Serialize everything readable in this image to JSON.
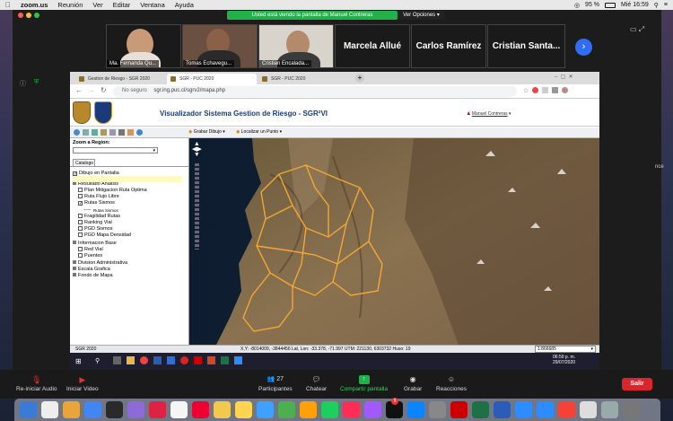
{
  "menubar": {
    "app": "zoom.us",
    "items": [
      "Reunión",
      "Ver",
      "Editar",
      "Ventana",
      "Ayuda"
    ],
    "battery": "95 %",
    "clock": "Mié 16:59"
  },
  "share": {
    "banner": "Usted está viendo la pantalla de Manuel Contreras",
    "options": "Ver Opciones"
  },
  "participants": [
    {
      "name": "Ma. Fernanda Qu..."
    },
    {
      "name": "Tomas Echavegu..."
    },
    {
      "name": "Cristian Encalada..."
    },
    {
      "name": "Marcela Allué"
    },
    {
      "name": "Carlos Ramírez"
    },
    {
      "name": "Cristian Santa..."
    }
  ],
  "browser": {
    "tabs": [
      "Gestion de Riesgo - SGR 2020",
      "SGR - PUC 2020",
      "SGR - PUC 2020"
    ],
    "security": "No seguro",
    "url": "sgr.ing.puc.cl/sgrv2/mapa.php"
  },
  "app": {
    "title": "Visualizador Sistema Gestion de Riesgo - SGR²VI",
    "user": "Manuel Contreras",
    "toolbar": {
      "draw": "Grabar Dibujo",
      "locate": "Localizar un Punto"
    }
  },
  "panel": {
    "zoom_label": "Zoom a Region:",
    "catalog_tab": "Catalogo",
    "items": [
      {
        "label": "Dibujo en Pantalla",
        "checked": true,
        "indent": 1
      },
      {
        "label": "Resultado Analisis",
        "checked": false,
        "indent": 1,
        "folder": true
      },
      {
        "label": "Plan Mitigacion Ruta Optima",
        "checked": false,
        "indent": 2
      },
      {
        "label": "Ruta Flujo Libre",
        "checked": false,
        "indent": 2
      },
      {
        "label": "Rutas Sismos",
        "checked": true,
        "indent": 2
      },
      {
        "label": "Rutas Sismos",
        "checked": false,
        "indent": 3,
        "legend": true
      },
      {
        "label": "Fragilidad Rutas",
        "checked": false,
        "indent": 2
      },
      {
        "label": "Ranking Vial",
        "checked": false,
        "indent": 2
      },
      {
        "label": "PGD Sismos",
        "checked": false,
        "indent": 2
      },
      {
        "label": "PGD Mapa Densidad",
        "checked": false,
        "indent": 2
      },
      {
        "label": "Informacion Base",
        "checked": false,
        "indent": 1,
        "folder": true
      },
      {
        "label": "Red Vial",
        "checked": false,
        "indent": 2
      },
      {
        "label": "Puentes",
        "checked": false,
        "indent": 2
      },
      {
        "label": "Division Administrativa",
        "checked": false,
        "indent": 1,
        "folder": true
      },
      {
        "label": "Escala Grafica",
        "checked": false,
        "indent": 1,
        "folder": true
      },
      {
        "label": "Fondo de Mapa",
        "checked": false,
        "indent": 1,
        "folder": true
      }
    ]
  },
  "status": {
    "left": "SGR 2020",
    "coords": "X,Y: -8014009, -3844456  Lat, Lon: -33.378, -71.997  UTM: 221130, 6303732  Huso: 19",
    "scale": "1:866685"
  },
  "taskbar": {
    "time": "06:59 p. m.",
    "date": "29/07/2020"
  },
  "controls": {
    "audio": "Re-iniciar Audio",
    "video": "Iniciar Video",
    "participants": "Participantes",
    "participants_count": "27",
    "chat": "Chatear",
    "share": "Compartir pantalla",
    "record": "Grabar",
    "reactions": "Reacciones",
    "leave": "Salir"
  },
  "side_text": "nce",
  "dock_badge": "9",
  "colors": {
    "route": "#f2a733",
    "share_green": "#22b04a",
    "leave_red": "#d9262c",
    "title_blue": "#1a3a7a"
  }
}
